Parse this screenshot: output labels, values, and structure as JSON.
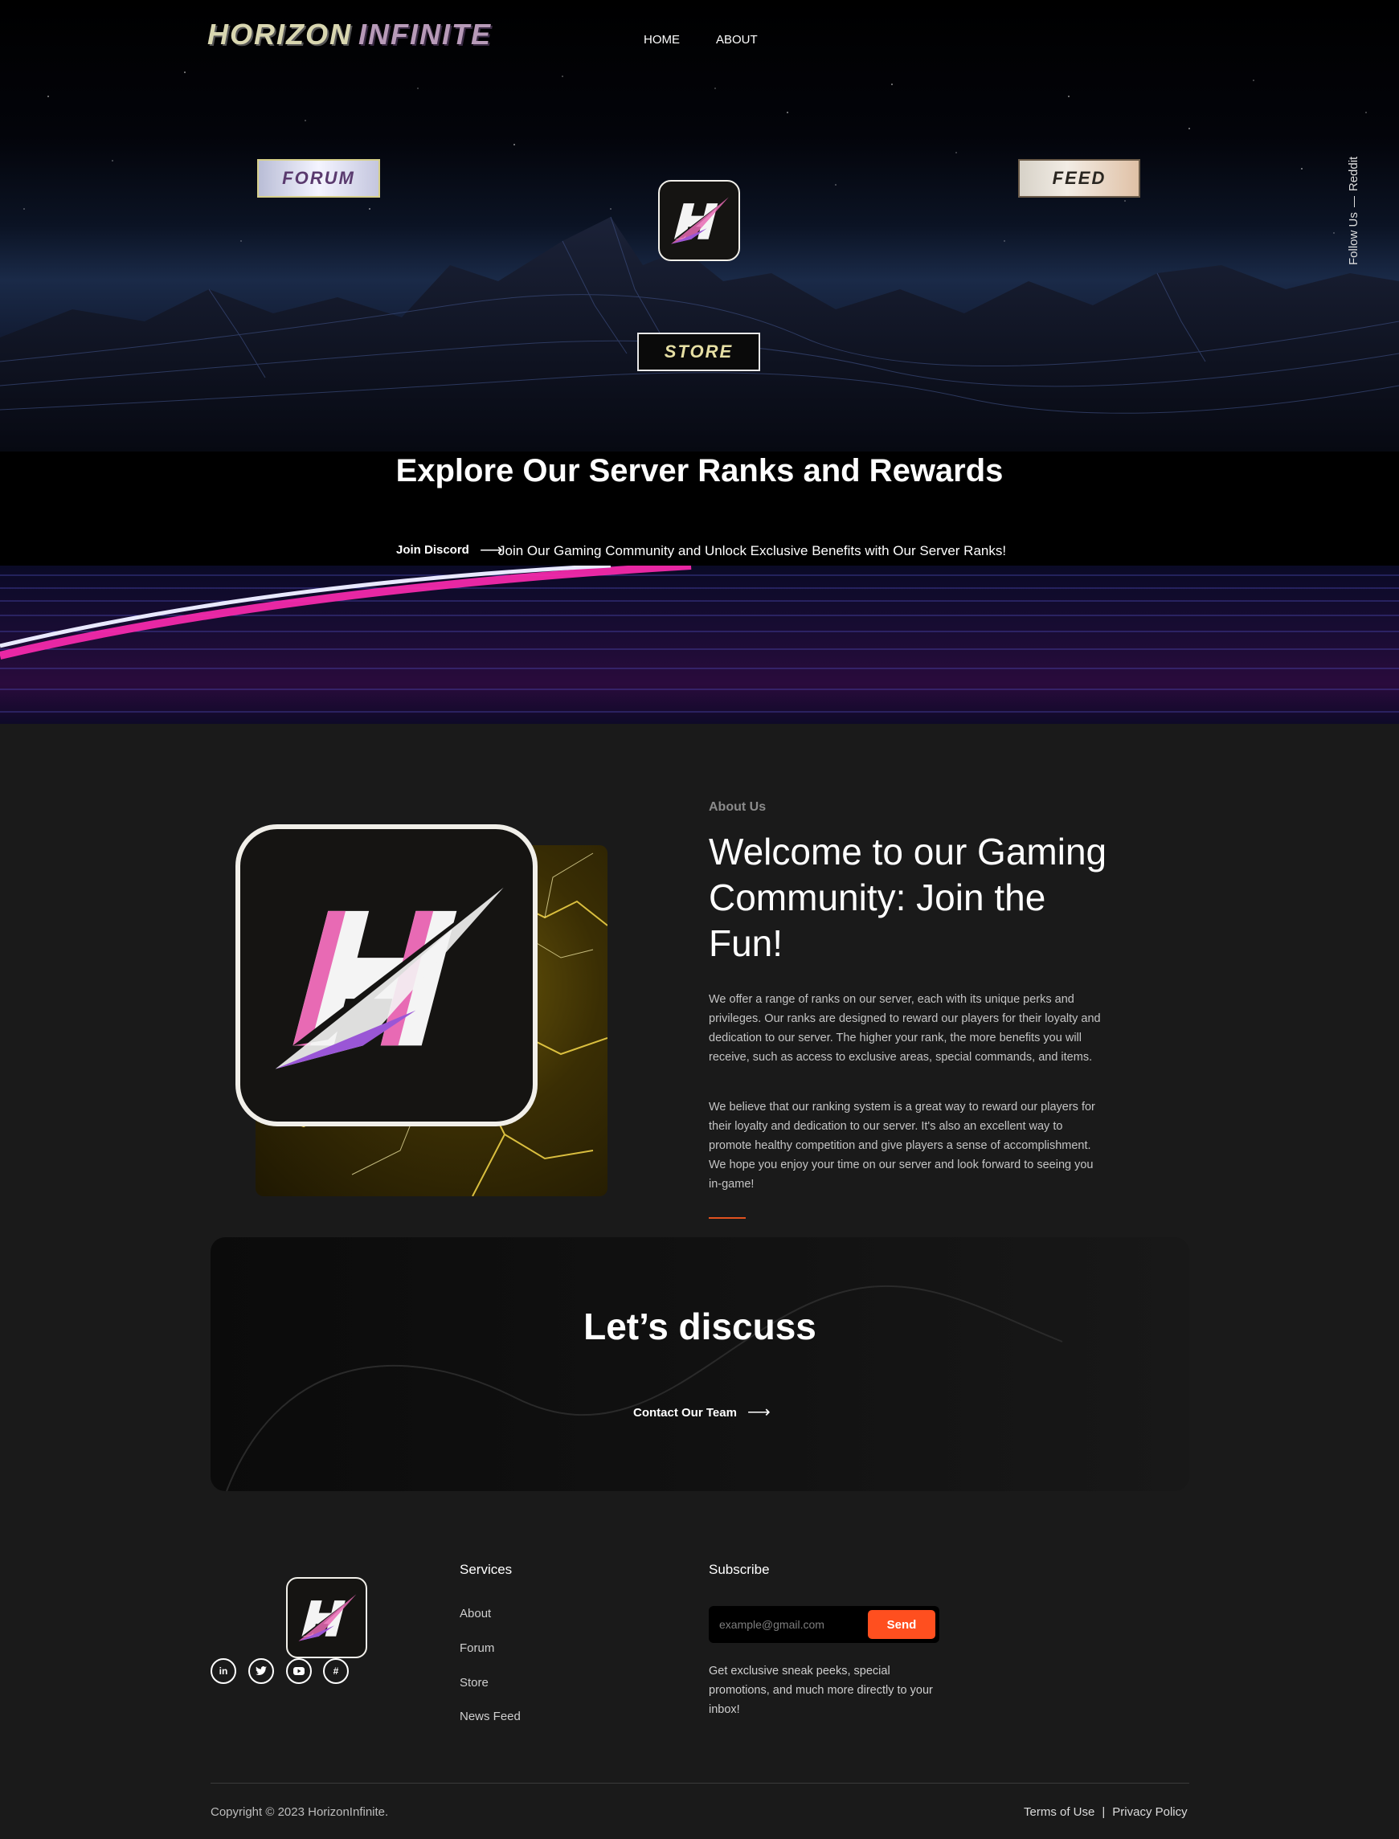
{
  "header": {
    "logo_word1": "HORIZON",
    "logo_word2": "INFINITE",
    "nav": [
      {
        "label": "HOME"
      },
      {
        "label": "ABOUT"
      }
    ]
  },
  "hero": {
    "forum_label": "FORUM",
    "feed_label": "FEED",
    "store_label": "STORE",
    "follow_label": "Follow Us",
    "social_vertical": "Reddit",
    "title": "Explore Our Server Ranks and Rewards",
    "join_label": "Join Discord",
    "tagline": "Join Our Gaming Community and Unlock Exclusive Benefits with Our Server Ranks!"
  },
  "about": {
    "eyebrow": "About Us",
    "heading": "Welcome to our Gaming Community: Join the Fun!",
    "p1": "We offer a range of ranks on our server, each with its unique perks and privileges. Our ranks are designed to reward our players for their loyalty and dedication to our server. The higher your rank, the more benefits you will receive, such as access to exclusive areas, special commands, and items.",
    "p2": "We believe that our ranking system is a great way to reward our players for their loyalty and dedication to our server. It's also an excellent way to promote healthy competition and give players a sense of accomplishment. We hope you enjoy your time on our server and look forward to seeing you in-game!"
  },
  "discuss": {
    "title": "Let’s discuss",
    "contact_label": "Contact Our Team"
  },
  "footer": {
    "services_title": "Services",
    "services": [
      {
        "label": "About"
      },
      {
        "label": "Forum"
      },
      {
        "label": "Store"
      },
      {
        "label": "News Feed"
      }
    ],
    "subscribe_title": "Subscribe",
    "email_placeholder": "example@gmail.com",
    "send_label": "Send",
    "subscribe_text": "Get exclusive sneak peeks, special promotions, and much more directly to your inbox!",
    "socials": [
      {
        "icon": "linkedin-icon"
      },
      {
        "icon": "twitter-icon"
      },
      {
        "icon": "youtube-icon"
      },
      {
        "icon": "slack-icon"
      }
    ],
    "copyright": "Copyright © 2023 HorizonInfinite.",
    "terms": "Terms of Use",
    "separator": "|",
    "privacy": "Privacy Policy"
  },
  "colors": {
    "accent": "#ff4f1f",
    "logo_pink": "#e86ab4",
    "logo_purple": "#9a56d6",
    "background": "#1a1a1a"
  }
}
